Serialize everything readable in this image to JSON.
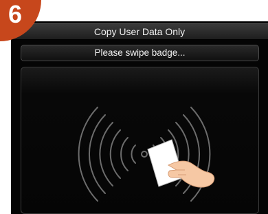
{
  "step": {
    "number": "6"
  },
  "header": {
    "title": "Copy User Data Only"
  },
  "prompt": {
    "text": "Please swipe badge..."
  },
  "icons": {
    "reader": "rfid-wave-icon",
    "badge": "badge-card-icon",
    "hand": "hand-icon"
  },
  "colors": {
    "badge_accent": "#c7471c",
    "screen_bg": "#050505",
    "text": "#f2f2f2"
  }
}
